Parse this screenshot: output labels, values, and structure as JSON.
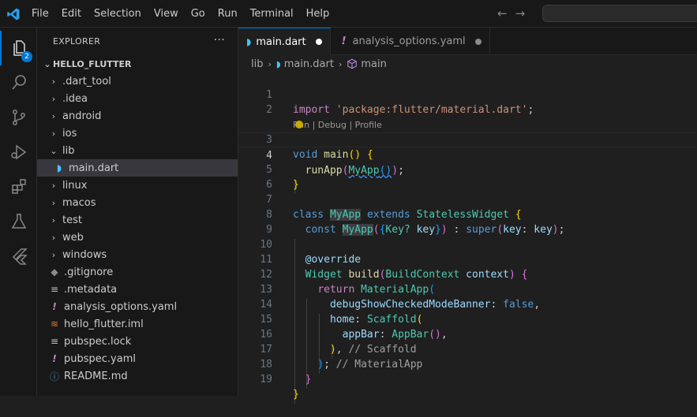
{
  "menu": [
    "File",
    "Edit",
    "Selection",
    "View",
    "Go",
    "Run",
    "Terminal",
    "Help"
  ],
  "activity": {
    "badge": "2"
  },
  "explorer": {
    "title": "EXPLORER",
    "more": "···",
    "folder": "HELLO_FLUTTER",
    "items": [
      {
        "name": ".dart_tool",
        "type": "folder"
      },
      {
        "name": ".idea",
        "type": "folder"
      },
      {
        "name": "android",
        "type": "folder"
      },
      {
        "name": "ios",
        "type": "folder"
      },
      {
        "name": "lib",
        "type": "folder-open"
      },
      {
        "name": "main.dart",
        "type": "dart"
      },
      {
        "name": "linux",
        "type": "folder"
      },
      {
        "name": "macos",
        "type": "folder"
      },
      {
        "name": "test",
        "type": "folder"
      },
      {
        "name": "web",
        "type": "folder"
      },
      {
        "name": "windows",
        "type": "folder"
      },
      {
        "name": ".gitignore",
        "type": "git"
      },
      {
        "name": ".metadata",
        "type": "file"
      },
      {
        "name": "analysis_options.yaml",
        "type": "yaml"
      },
      {
        "name": "hello_flutter.iml",
        "type": "rss"
      },
      {
        "name": "pubspec.lock",
        "type": "file"
      },
      {
        "name": "pubspec.yaml",
        "type": "yaml"
      },
      {
        "name": "README.md",
        "type": "info"
      }
    ]
  },
  "tabs": [
    {
      "label": "main.dart",
      "active": true
    },
    {
      "label": "analysis_options.yaml",
      "active": false
    }
  ],
  "breadcrumb": {
    "folder": "lib",
    "file": "main.dart",
    "symbol": "main"
  },
  "codelens": "Run | Debug | Profile",
  "line_numbers": [
    "1",
    "2",
    "3",
    "4",
    "5",
    "6",
    "7",
    "8",
    "9",
    "10",
    "11",
    "12",
    "13",
    "14",
    "15",
    "16",
    "17",
    "18",
    "19"
  ],
  "code": {
    "l1": {
      "kw": "import",
      "str": "'package:flutter/material.dart'",
      "end": ";"
    },
    "l3": {
      "kw": "void",
      "fn": "main",
      "p": "()",
      "b": "{"
    },
    "l4": {
      "fn": "runApp",
      "o": "(",
      "cls": "MyApp",
      "i": "()",
      "c": ")",
      "end": ";"
    },
    "l5": {
      "b": "}"
    },
    "l7": {
      "kw": "class",
      "cls": "MyApp",
      "kw2": "extends",
      "cls2": "StatelessWidget",
      "b": "{"
    },
    "l8": {
      "kw": "const",
      "cls": "MyApp",
      "o": "(",
      "ob": "{",
      "t": "Key?",
      "v": "key",
      "cb": "}",
      "c": ")",
      "colon": " : ",
      "sup": "super",
      "o2": "(",
      "v2": "key",
      "v3": "key",
      "c2": ")",
      "end": ";"
    },
    "l10": {
      "anno": "@override"
    },
    "l11": {
      "cls": "Widget",
      "fn": "build",
      "o": "(",
      "cls2": "BuildContext",
      "v": "context",
      "c": ")",
      "b": "{"
    },
    "l12": {
      "kw": "return",
      "cls": "MaterialApp",
      "o": "("
    },
    "l13": {
      "v": "debugShowCheckedModeBanner",
      "kw": "false",
      "end": ","
    },
    "l14": {
      "v": "home",
      "cls": "Scaffold",
      "o": "("
    },
    "l15": {
      "v": "appBar",
      "cls": "AppBar",
      "o": "()",
      "end": ","
    },
    "l16": {
      "c": ")",
      "end": ",",
      "cm": "// Scaffold"
    },
    "l17": {
      "c": ")",
      "end": ";",
      "cm": "// MaterialApp"
    },
    "l18": {
      "b": "}"
    },
    "l19": {
      "b": "}"
    }
  }
}
